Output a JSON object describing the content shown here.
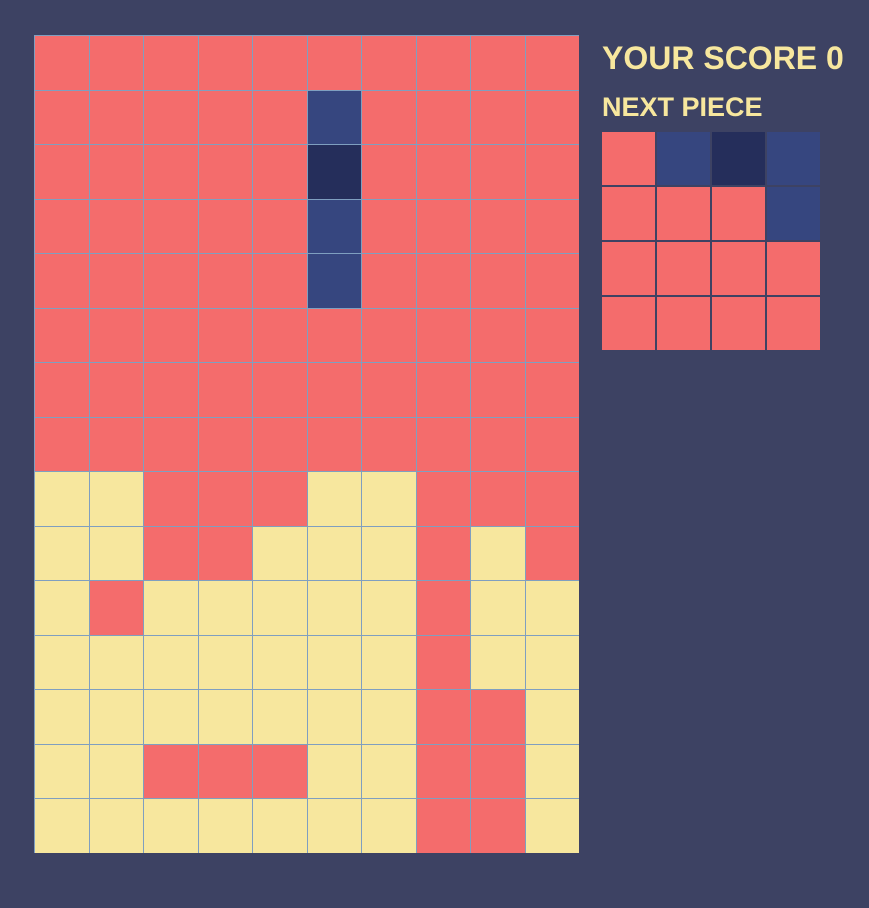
{
  "colors": {
    "background": "#3d4263",
    "e": "#f46c6c",
    "f": "#f7e79e",
    "p": "#36467f",
    "d": "#252e5b"
  },
  "score": {
    "label": "YOUR SCORE",
    "value": "0"
  },
  "next_piece": {
    "title": "NEXT PIECE",
    "grid": [
      "epdp",
      "eeep",
      "eeee",
      "eeee"
    ]
  },
  "board": {
    "rows": [
      "eeeeeeeeee",
      "eeeeepeeee",
      "eeeeedeeee",
      "eeeeepeeee",
      "eeeeepeeee",
      "eeeeeeeeee",
      "eeeeeeeeee",
      "eeeeeeeeee",
      "ffeeeffeee",
      "ffeefffefe",
      "fefffffeff",
      "fffffffeff",
      "fffffffeef",
      "ffeeeffeef",
      "fffffffeef"
    ]
  }
}
